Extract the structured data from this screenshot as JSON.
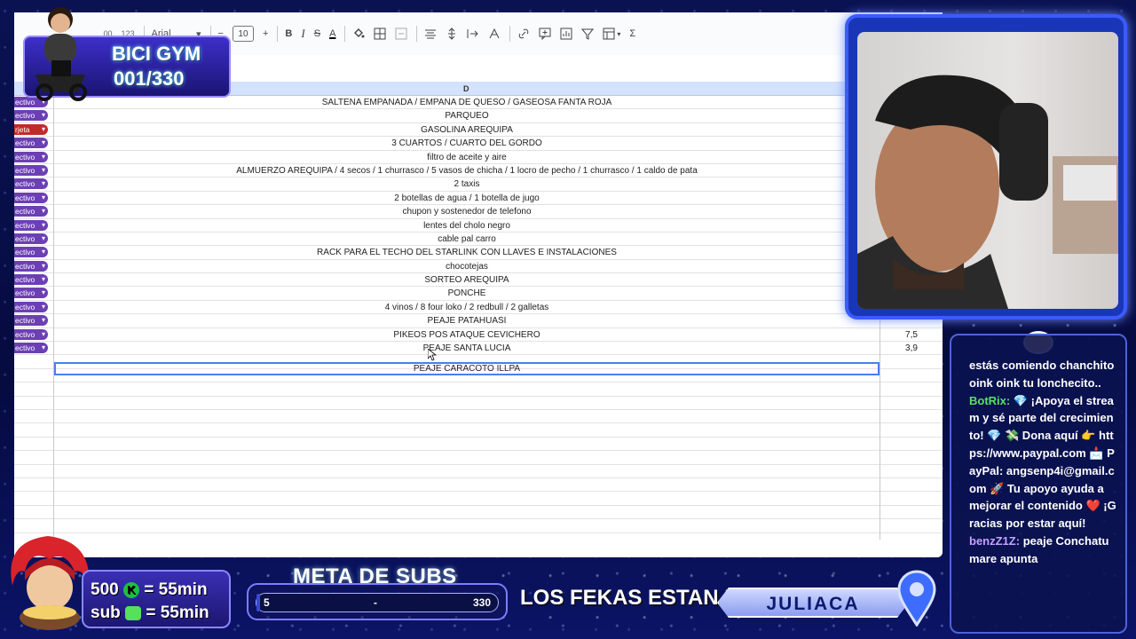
{
  "toolbar": {
    "zoom_fragment": ".00",
    "format_123": "123",
    "font_name": "Arial",
    "font_size": "10",
    "minus": "−",
    "plus": "+",
    "bold": "B",
    "italic": "I",
    "strike": "S",
    "text_color": "A",
    "sum": "Σ"
  },
  "sheet": {
    "column_label": "D",
    "rows": [
      {
        "category": "ectivo",
        "category_color": "purple",
        "description": "SALTENA EMPANADA / EMPANA DE QUESO / GASEOSA FANTA ROJA",
        "amount": ""
      },
      {
        "category": "ectivo",
        "category_color": "purple",
        "description": "PARQUEO",
        "amount": ""
      },
      {
        "category": "rjeta",
        "category_color": "red",
        "description": "GASOLINA AREQUIPA",
        "amount": ""
      },
      {
        "category": "ectivo",
        "category_color": "purple",
        "description": "3 CUARTOS / CUARTO DEL GORDO",
        "amount": ""
      },
      {
        "category": "ectivo",
        "category_color": "purple",
        "description": "filtro de aceite y aire",
        "amount": ""
      },
      {
        "category": "ectivo",
        "category_color": "purple",
        "description": "ALMUERZO AREQUIPA / 4 secos / 1 churrasco / 5 vasos de chicha / 1 locro de pecho / 1 churrasco / 1 caldo de pata",
        "amount": ""
      },
      {
        "category": "ectivo",
        "category_color": "purple",
        "description": "2 taxis",
        "amount": ""
      },
      {
        "category": "ectivo",
        "category_color": "purple",
        "description": "2 botellas de agua / 1 botella de jugo",
        "amount": ""
      },
      {
        "category": "ectivo",
        "category_color": "purple",
        "description": "chupon y sostenedor de telefono",
        "amount": ""
      },
      {
        "category": "ectivo",
        "category_color": "purple",
        "description": "lentes del cholo negro",
        "amount": ""
      },
      {
        "category": "ectivo",
        "category_color": "purple",
        "description": "cable pal carro",
        "amount": ""
      },
      {
        "category": "ectivo",
        "category_color": "purple",
        "description": "RACK PARA EL TECHO DEL STARLINK CON LLAVES E INSTALACIONES",
        "amount": ""
      },
      {
        "category": "ectivo",
        "category_color": "purple",
        "description": "chocotejas",
        "amount": ""
      },
      {
        "category": "ectivo",
        "category_color": "purple",
        "description": "SORTEO AREQUIPA",
        "amount": ""
      },
      {
        "category": "ectivo",
        "category_color": "purple",
        "description": "PONCHE",
        "amount": ""
      },
      {
        "category": "ectivo",
        "category_color": "purple",
        "description": "4 vinos / 8 four loko / 2 redbull / 2 galletas",
        "amount": ""
      },
      {
        "category": "ectivo",
        "category_color": "purple",
        "description": "PEAJE PATAHUASI",
        "amount": ""
      },
      {
        "category": "ectivo",
        "category_color": "purple",
        "description": "PIKEOS POS ATAQUE CEVICHERO",
        "amount": "7,5"
      },
      {
        "category": "ectivo",
        "category_color": "purple",
        "description": "PEAJE SANTA LUCIA",
        "amount": "3,9"
      }
    ],
    "editing_cell": "PEAJE CARACOTO ILLPA"
  },
  "overlay": {
    "bici_title": "BICI GYM",
    "bici_count": "001/330",
    "sub_line_1_left": "500",
    "sub_line_1_right": "= 55min",
    "sub_line_2_left": "sub",
    "sub_line_2_right": "= 55min",
    "meta_title": "META DE SUBS",
    "meta_start": "5",
    "meta_mid": "-",
    "meta_end": "330",
    "meta_progress": 0.015,
    "fekas": "LOS FEKAS ESTAN EN:",
    "location": "JULIACA"
  },
  "chat": {
    "msg1": "estás comiendo chanchito oink oink tu lonchecito..",
    "bot_user": "BotRix:",
    "bot_msg": "💎 ¡Apoya el stream y sé parte del crecimiento! 💎 💸 Dona aquí 👉 https://www.paypal.com 📩 PayPal: angsenp4i@gmail.com 🚀 Tu apoyo ayuda a mejorar el contenido ❤️ ¡Gracias por estar aquí!",
    "user2": "benzZ1Z:",
    "msg2": "peaje Conchatumare apunta"
  },
  "colors": {
    "accent": "#3a5cff",
    "chip_purple": "#6c3fb5",
    "chip_red": "#c22a2a",
    "selection": "#4a7ef0"
  }
}
